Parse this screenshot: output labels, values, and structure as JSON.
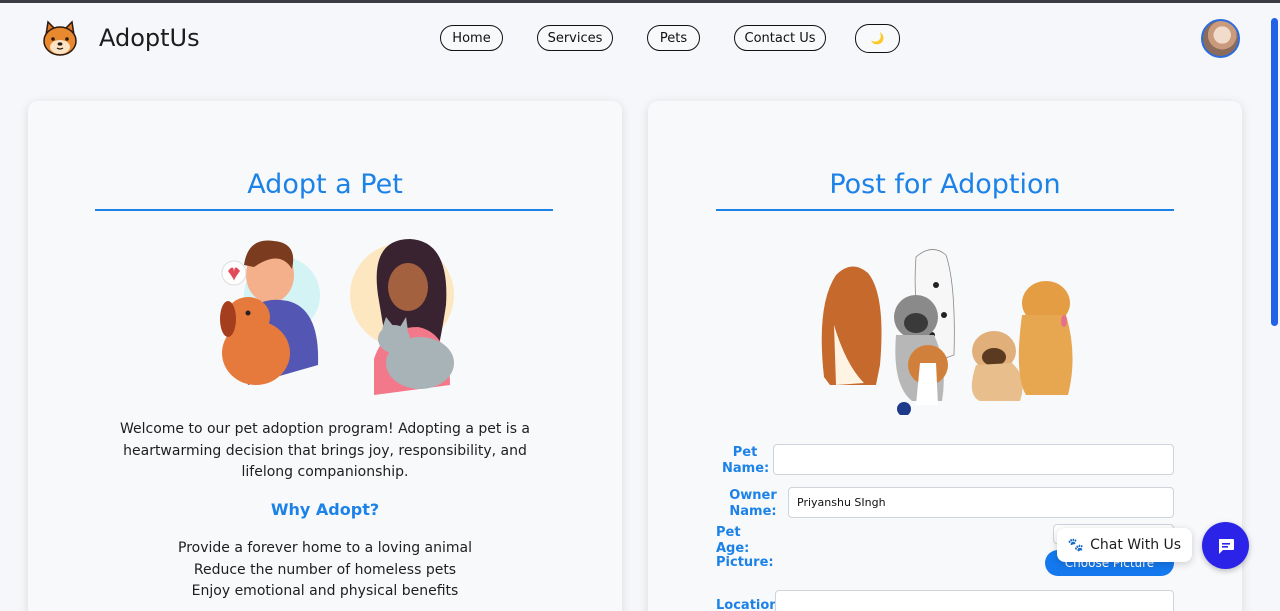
{
  "navbar": {
    "brand": "AdoptUs",
    "links": [
      "Home",
      "Services",
      "Pets",
      "Contact Us"
    ],
    "theme_toggle_icon": "🌙"
  },
  "adopt": {
    "title": "Adopt a Pet",
    "welcome": "Welcome to our pet adoption program! Adopting a pet is a heartwarming decision that brings joy, responsibility, and lifelong companionship.",
    "why_title": "Why Adopt?",
    "benefits": [
      "Provide a forever home to a loving animal",
      "Reduce the number of homeless pets",
      "Enjoy emotional and physical benefits"
    ]
  },
  "post": {
    "title": "Post for Adoption",
    "pet_name_label": "Pet Name:",
    "pet_name_value": "",
    "owner_name_label": "Owner Name:",
    "owner_name_value": "Priyanshu SIngh",
    "pet_age_label": "Pet Age:",
    "picture_label": "Picture:",
    "choose_picture": "Choose Picture",
    "location_label": "Location:"
  },
  "chat": {
    "label": "Chat With Us",
    "paw_icon": "🐾"
  },
  "colors": {
    "accent": "#1c82e8",
    "chat_button": "#2b24e8",
    "scrollbar": "#2162e8"
  }
}
